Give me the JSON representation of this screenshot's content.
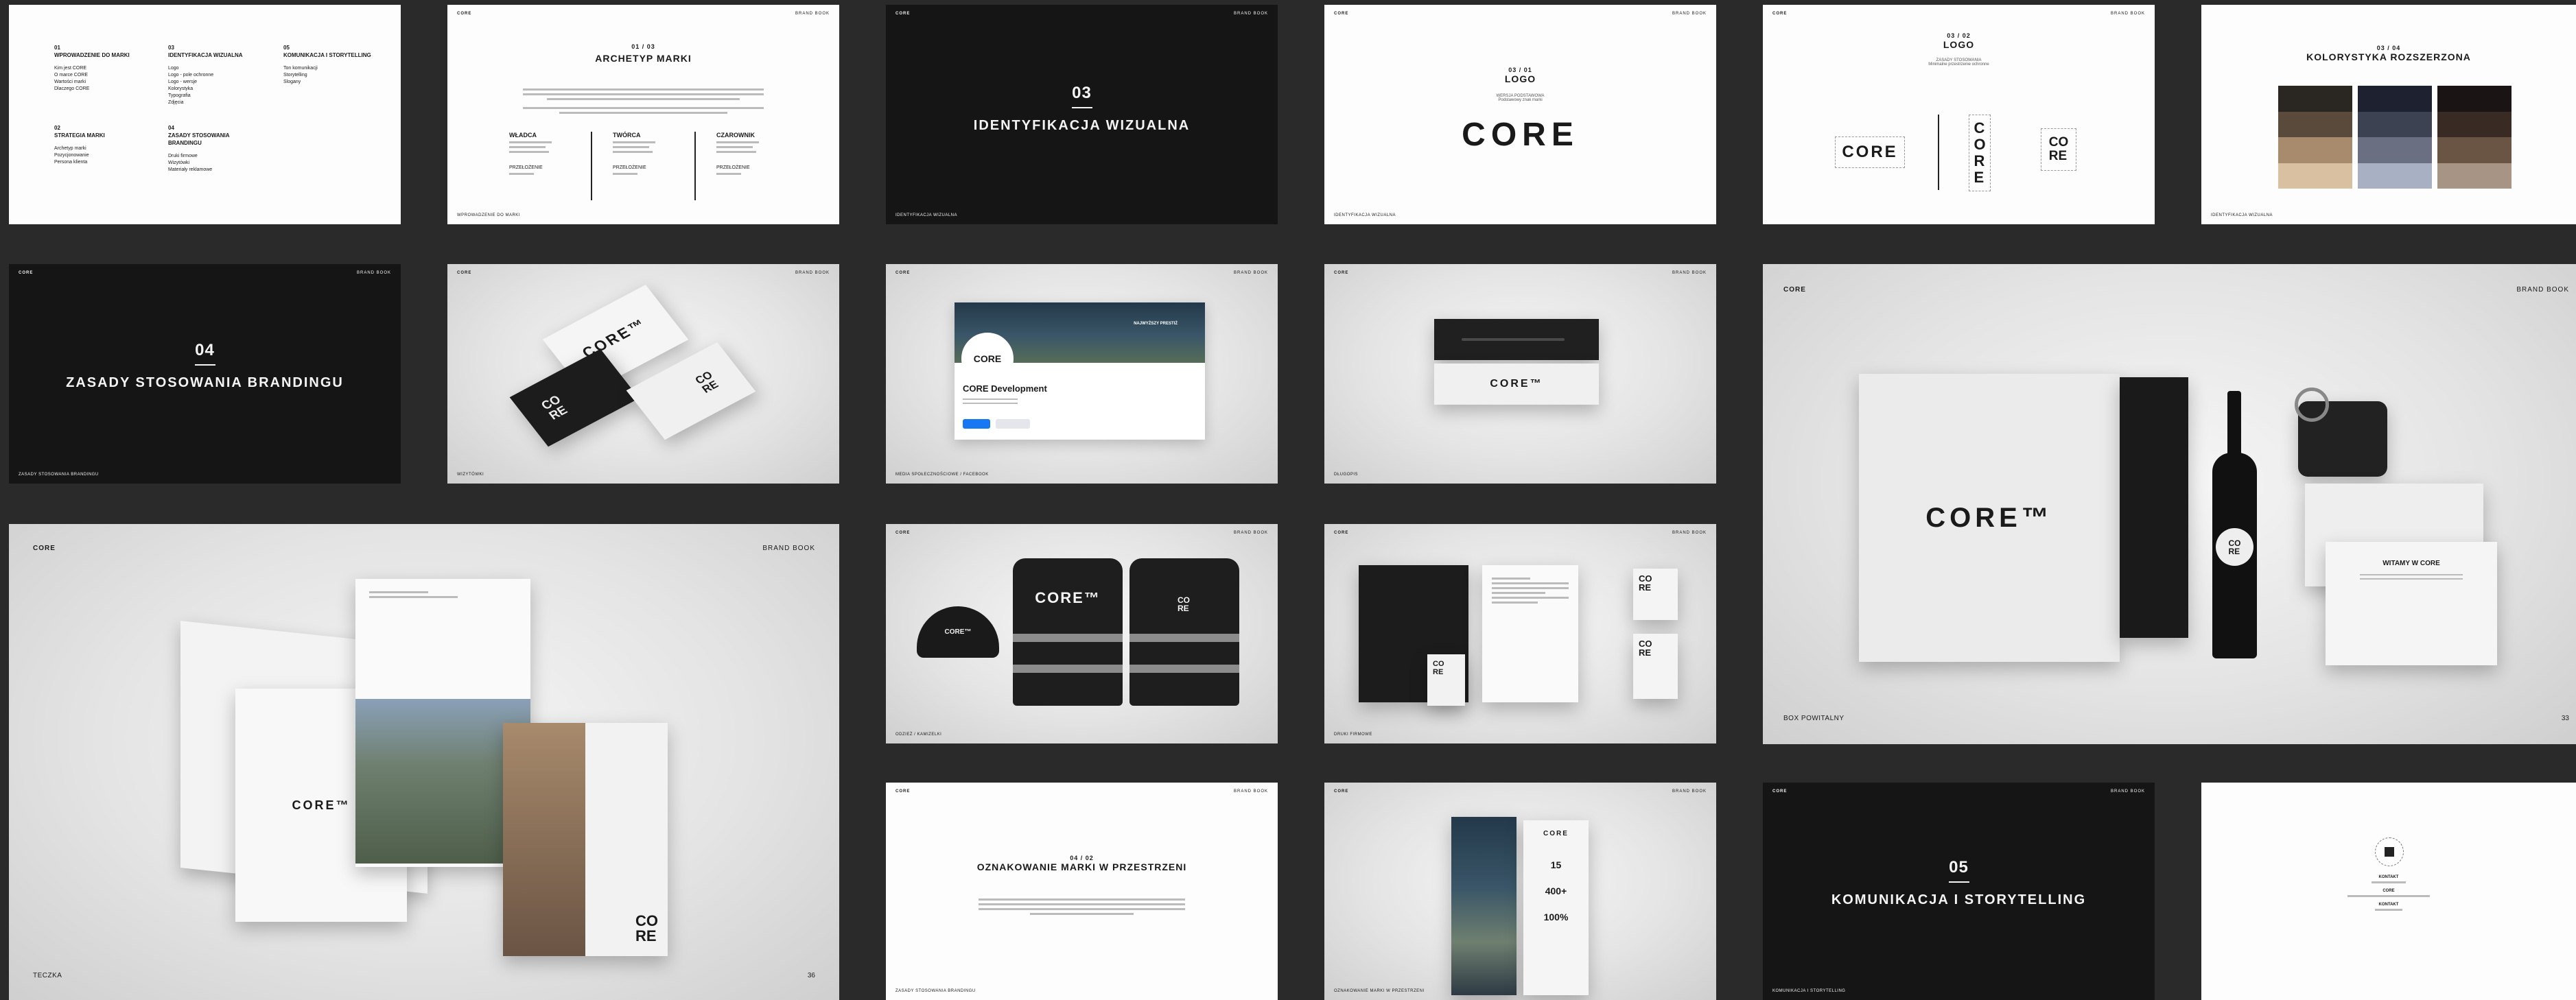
{
  "brand": "CORE",
  "brand_tm": "CORE™",
  "header_right": "BRAND BOOK",
  "slide1": {
    "toc": [
      {
        "num": "01",
        "title": "WPROWADZENIE DO MARKI",
        "items": [
          "Kim jest CORE",
          "O marce CORE",
          "Wartości marki",
          "Dlaczego CORE"
        ]
      },
      {
        "num": "02",
        "title": "STRATEGIA MARKI",
        "items": [
          "Archetyp marki",
          "Pozycjonowanie",
          "Persona klienta"
        ]
      },
      {
        "num": "03",
        "title": "IDENTYFIKACJA WIZUALNA",
        "items": [
          "Logo",
          "Logo - pole ochronne",
          "Logo - wersje",
          "Kolorystyka",
          "Typografia",
          "Zdjęcia"
        ]
      },
      {
        "num": "04",
        "title": "ZASADY STOSOWANIA BRANDINGU",
        "items": [
          "Druki firmowe",
          "Wizytówki",
          "Materiały reklamowe"
        ]
      },
      {
        "num": "05",
        "title": "KOMUNIKACJA I STORYTELLING",
        "items": [
          "Ton komunikacji",
          "Storytelling",
          "Slogany"
        ]
      }
    ]
  },
  "slide2": {
    "num": "01 / 03",
    "title": "ARCHETYP MARKI",
    "cols": [
      {
        "title": "WŁADCA",
        "foot": "PRZEŁOŻENIE"
      },
      {
        "title": "TWÓRCA",
        "foot": "PRZEŁOŻENIE"
      },
      {
        "title": "CZAROWNIK",
        "foot": "PRZEŁOŻENIE"
      }
    ],
    "footer": "WPROWADZENIE DO MARKI"
  },
  "slide3": {
    "num": "03",
    "title": "IDENTYFIKACJA WIZUALNA",
    "footer": "IDENTYFIKACJA WIZUALNA"
  },
  "slide4": {
    "num": "03 / 01",
    "title": "LOGO",
    "sub1": "WERSJA PODSTAWOWA",
    "sub2": "Podstawowy znak marki",
    "footer": "IDENTYFIKACJA WIZUALNA"
  },
  "slide5": {
    "num": "03 / 02",
    "title": "LOGO",
    "sub1": "ZASADY STOSOWANIA",
    "sub2": "Minimalne przestrzenie ochronne"
  },
  "slide6": {
    "num": "03 / 04",
    "title": "KOLORYSTYKA ROZSZERZONA",
    "footer": "IDENTYFIKACJA WIZUALNA",
    "colors": [
      [
        "#2a2622",
        "#5a4a3c",
        "#a88a6c",
        "#d8c0a0"
      ],
      [
        "#1e2230",
        "#3c4252",
        "#6a7082",
        "#a8b0c4"
      ],
      [
        "#1a1414",
        "#3a2a24",
        "#6a5444",
        "#a89484"
      ]
    ]
  },
  "slide7": {
    "num": "04",
    "title": "ZASADY STOSOWANIA BRANDINGU",
    "footer": "ZASADY STOSOWANIA BRANDINGU"
  },
  "slide8": {
    "footer": "WIZYTÓWKI"
  },
  "slide9": {
    "profile_name": "CORE Development",
    "cover_text": "NAJWYŻSZY PRESTIŻ",
    "footer": "MEDIA SPOŁECZNOŚCIOWE / FACEBOOK"
  },
  "slide10": {
    "footer": "DŁUGOPIS"
  },
  "slide11": {
    "footer": "BOX POWITALNY",
    "page": "33",
    "card_text": "WITAMY W CORE"
  },
  "slide12": {
    "footer": "TECZKA",
    "page": "36"
  },
  "slide13": {
    "footer": "ODZIEŻ / KAMIZELKI"
  },
  "slide14": {
    "footer": "DRUKI FIRMOWE"
  },
  "slide15": {
    "num": "04 / 02",
    "title": "OZNAKOWANIE MARKI W PRZESTRZENI",
    "footer": "ZASADY STOSOWANIA BRANDINGU"
  },
  "slide16": {
    "footer": "OZNAKOWANIE MARKI W PRZESTRZENI",
    "stat1": "15",
    "stat2": "400+",
    "stat3": "100%"
  },
  "slide17": {
    "num": "05",
    "title": "KOMUNIKACJA I STORYTELLING",
    "footer": "KOMUNIKACJA I STORYTELLING"
  },
  "slide18": {
    "label1": "KONTAKT",
    "label2": "CORE",
    "label3": "KONTAKT"
  }
}
